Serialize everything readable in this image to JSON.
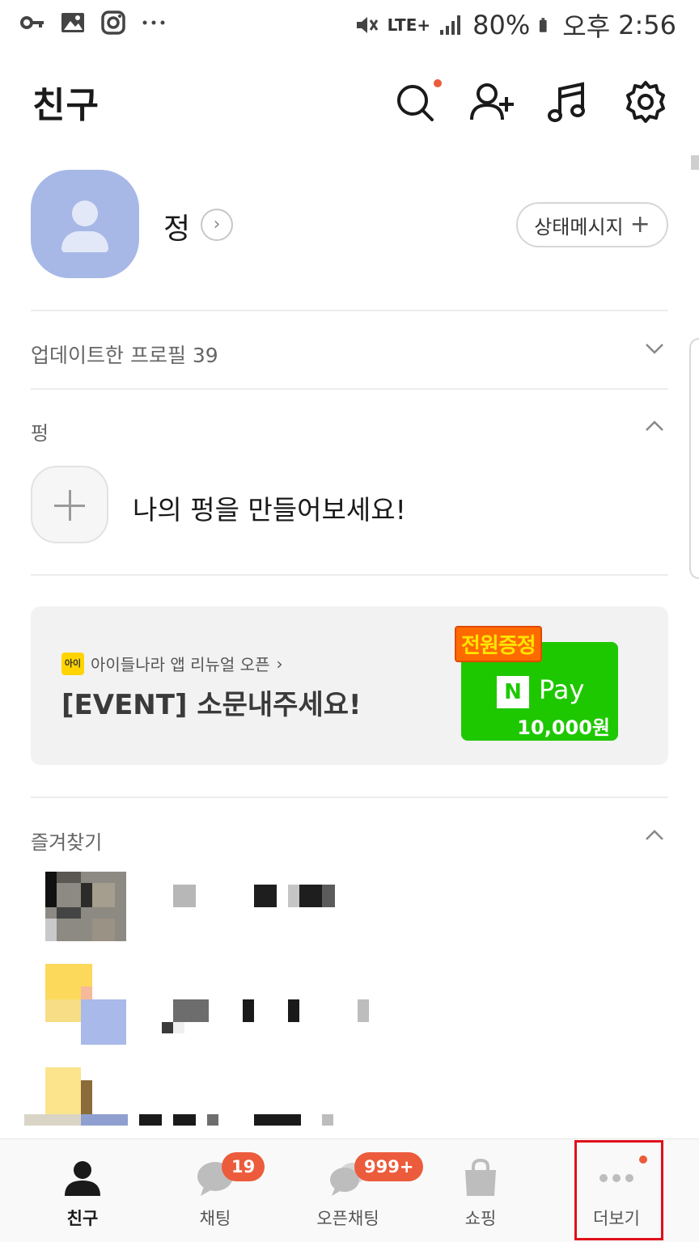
{
  "status_bar": {
    "battery": "80%",
    "network": "LTE+",
    "period": "오후",
    "time": "2:56",
    "left_icons": [
      "key-icon",
      "gallery-icon",
      "instagram-icon",
      "more-dots-icon"
    ]
  },
  "header": {
    "title": "친구",
    "actions": [
      "search-icon",
      "add-friend-icon",
      "music-icon",
      "settings-icon"
    ]
  },
  "profile": {
    "name": "정",
    "status_message_button": "상태메시지"
  },
  "sections": {
    "updated_profiles": "업데이트한 프로필 39",
    "pung": "펑",
    "pung_cta": "나의 펑을 만들어보세요!",
    "favorites": "즐겨찾기"
  },
  "banner": {
    "logo_text": "아이",
    "subtitle": "아이들나라 앱 리뉴얼 오픈",
    "title": "[EVENT] 소문내주세요!",
    "badge": "전원증정",
    "card_brand": "Pay",
    "card_amount": "10,000원"
  },
  "bottom_nav": {
    "items": [
      {
        "label": "친구",
        "icon": "person-icon",
        "active": true
      },
      {
        "label": "채팅",
        "icon": "chat-icon",
        "badge": "19"
      },
      {
        "label": "오픈채팅",
        "icon": "open-chat-icon",
        "badge": "999+"
      },
      {
        "label": "쇼핑",
        "icon": "shopping-bag-icon"
      },
      {
        "label": "더보기",
        "icon": "more-icon",
        "dot": true
      }
    ]
  },
  "colors": {
    "accent_red": "#ec5b3b",
    "avatar_blue": "#a7b8e7",
    "npay_green": "#1ec800"
  }
}
